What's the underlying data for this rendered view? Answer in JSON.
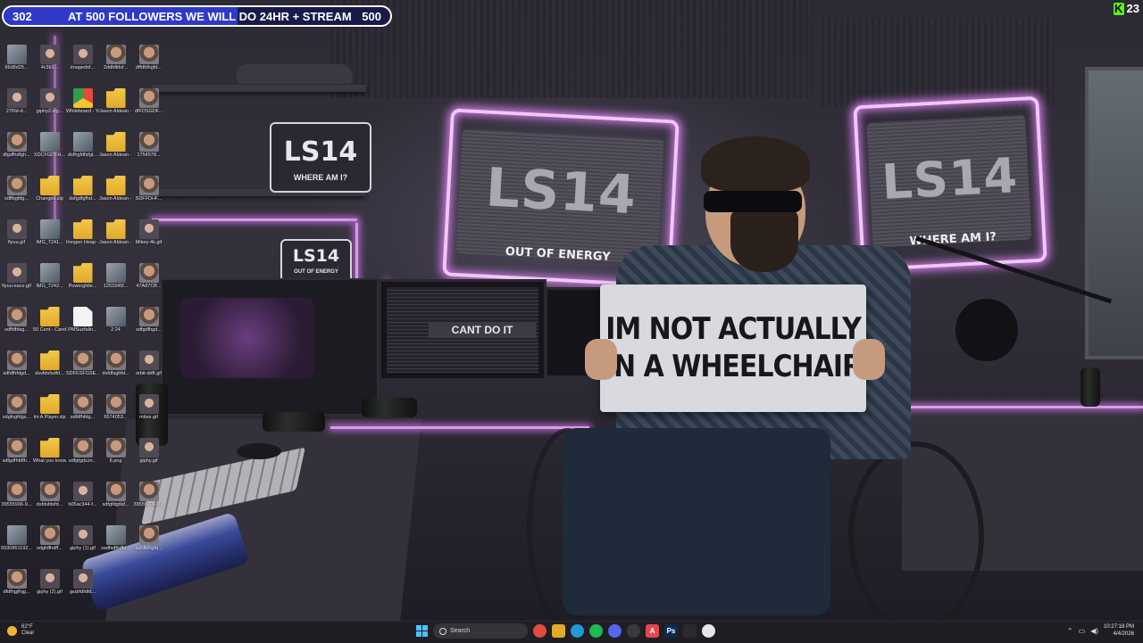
{
  "stream_goal": {
    "current": "302",
    "text": "AT 500 FOLLOWERS WE WILL DO 24HR + STREAM",
    "target": "500",
    "progress_fraction": 0.604,
    "bar_color": "#2f39c8"
  },
  "kick_viewers": {
    "icon": "kick-logo-icon",
    "count": "23",
    "color": "#53fc18"
  },
  "scene": {
    "neon_sign_center": {
      "big": "LS14",
      "small": "OUT OF ENERGY"
    },
    "neon_sign_right": {
      "big": "LS14",
      "small": "WHERE AM I?"
    },
    "shelf_sign": {
      "big": "LS14",
      "small": "WHERE AM I?"
    },
    "pc_sign": {
      "big": "LS14",
      "small": "OUT OF ENERGY"
    },
    "monitor_text": "CANT DO IT",
    "held_sign": {
      "line1": "IM NOT ACTUALLY",
      "line2": "IN A WHEELCHAIR"
    },
    "neon_color": "#d27be8"
  },
  "desktop_icons": [
    {
      "label": "66d8d25...",
      "icon": "image-icon"
    },
    {
      "label": "4c3b1...",
      "icon": "gif-icon"
    },
    {
      "label": "imagedsf...",
      "icon": "gif-icon"
    },
    {
      "label": "2ddfdfdsf...",
      "icon": "face-icon"
    },
    {
      "label": "dffdfdhgfd...",
      "icon": "face-icon"
    },
    {
      "label": "27f0d-d...",
      "icon": "gif-icon"
    },
    {
      "label": "giphy2-sig...",
      "icon": "gif-icon"
    },
    {
      "label": "Whiteboard - YouTube",
      "icon": "chrome-icon"
    },
    {
      "label": "Jason Aldean - She's Cou...",
      "icon": "folder-icon"
    },
    {
      "label": "dfFDSGDF...",
      "icon": "face-icon"
    },
    {
      "label": "dfgdfhdfgh...",
      "icon": "face-icon"
    },
    {
      "label": "XDCFGDFH...",
      "icon": "image-icon"
    },
    {
      "label": "dsfhgfdfsfgt...",
      "icon": "image-icon"
    },
    {
      "label": "Jason Aldean - Night Tra...",
      "icon": "folder-icon"
    },
    {
      "label": "1754578...",
      "icon": "face-icon"
    },
    {
      "label": "sdffbgfdg...",
      "icon": "face-icon"
    },
    {
      "label": "Changes.zip",
      "icon": "folder-icon"
    },
    {
      "label": "dsfgdfgfhd...",
      "icon": "folder-icon"
    },
    {
      "label": "Jason Aldean - Tonight I...",
      "icon": "folder-icon"
    },
    {
      "label": "SDFFDHF...",
      "icon": "face-icon"
    },
    {
      "label": "flyuu.gif",
      "icon": "gif-icon"
    },
    {
      "label": "IMG_7241...",
      "icon": "image-icon"
    },
    {
      "label": "Imogen Heap - Hid...",
      "icon": "folder-icon"
    },
    {
      "label": "Jason Aldean - My Kinda ...",
      "icon": "folder-icon"
    },
    {
      "label": "Mikey-4k.gif",
      "icon": "gif-icon"
    },
    {
      "label": "flyuu-eace.gif",
      "icon": "gif-icon"
    },
    {
      "label": "IMG_7242...",
      "icon": "image-icon"
    },
    {
      "label": "Powerglide...",
      "icon": "folder-icon"
    },
    {
      "label": "1253345f...",
      "icon": "image-icon"
    },
    {
      "label": "47A87CB...",
      "icon": "face-icon"
    },
    {
      "label": "sdffdfdsg...",
      "icon": "face-icon"
    },
    {
      "label": "50 Cent - Candy Sho...",
      "icon": "folder-icon"
    },
    {
      "label": "PMSuzfalin...",
      "icon": "document-icon"
    },
    {
      "label": "2:24",
      "icon": "image-icon"
    },
    {
      "label": "sdfgdfhgd...",
      "icon": "face-icon"
    },
    {
      "label": "sdfdfhfdgd...",
      "icon": "face-icon"
    },
    {
      "label": "dsvfdsfsdfd...",
      "icon": "folder-icon"
    },
    {
      "label": "SDFESFGSE...",
      "icon": "face-icon"
    },
    {
      "label": "dsfdfsgbfd...",
      "icon": "face-icon"
    },
    {
      "label": "orbit-ddft.gif",
      "icon": "gif-icon"
    },
    {
      "label": "sdgfsgfdgs...",
      "icon": "face-icon"
    },
    {
      "label": "Im A Player.zip",
      "icon": "folder-icon"
    },
    {
      "label": "sdfdfhfdg...",
      "icon": "face-icon"
    },
    {
      "label": "6574053...",
      "icon": "face-icon"
    },
    {
      "label": "mbxe.gif",
      "icon": "gif-icon"
    },
    {
      "label": "sdfgdfhfdfh...",
      "icon": "face-icon"
    },
    {
      "label": "What you know abo...",
      "icon": "folder-icon"
    },
    {
      "label": "sdfgfgdzzn...",
      "icon": "face-icon"
    },
    {
      "label": "8.png",
      "icon": "face-icon"
    },
    {
      "label": "giphy.gif",
      "icon": "gif-icon"
    },
    {
      "label": "39555906-9...",
      "icon": "face-icon"
    },
    {
      "label": "dsfdsfdsfd...",
      "icon": "face-icon"
    },
    {
      "label": "b05ac344-f...",
      "icon": "gif-icon"
    },
    {
      "label": "sdfgfdgdsf...",
      "icon": "face-icon"
    },
    {
      "label": "39555906-9...",
      "icon": "face-icon"
    },
    {
      "label": "6590861192...",
      "icon": "image-icon"
    },
    {
      "label": "sdgfdfhdff...",
      "icon": "face-icon"
    },
    {
      "label": "giphy (1).gif",
      "icon": "gif-icon"
    },
    {
      "label": "sadfsdfsdfd...",
      "icon": "image-icon"
    },
    {
      "label": "asfdfdhgfd...",
      "icon": "face-icon"
    },
    {
      "label": "dfdfhgjfhjg...",
      "icon": "face-icon"
    },
    {
      "label": "giphy (2).gif",
      "icon": "gif-icon"
    },
    {
      "label": "gsdrfdfdfd...",
      "icon": "gif-icon"
    }
  ],
  "taskbar": {
    "weather_temp": "62°F",
    "weather_desc": "Clear",
    "search_placeholder": "Search",
    "apps": [
      {
        "name": "chrome-icon",
        "glyph": "",
        "color": "#e24b3b"
      },
      {
        "name": "file-explorer-icon",
        "glyph": "",
        "color": "#e2a92a"
      },
      {
        "name": "edge-icon",
        "glyph": "",
        "color": "#1f9ad6"
      },
      {
        "name": "spotify-icon",
        "glyph": "",
        "color": "#1db954"
      },
      {
        "name": "discord-icon",
        "glyph": "",
        "color": "#5865f2"
      },
      {
        "name": "obs-icon",
        "glyph": "",
        "color": "#3a3a3a"
      },
      {
        "name": "adobe-icon",
        "glyph": "A",
        "color": "#e34850"
      },
      {
        "name": "photoshop-icon",
        "glyph": "Ps",
        "color": "#0b2b52"
      },
      {
        "name": "terminal-icon",
        "glyph": "",
        "color": "#2b2b2b"
      },
      {
        "name": "white-circle-app-icon",
        "glyph": "",
        "color": "#e6e6e6"
      }
    ],
    "time": "10:27:18 PM",
    "date": "4/4/2026"
  }
}
